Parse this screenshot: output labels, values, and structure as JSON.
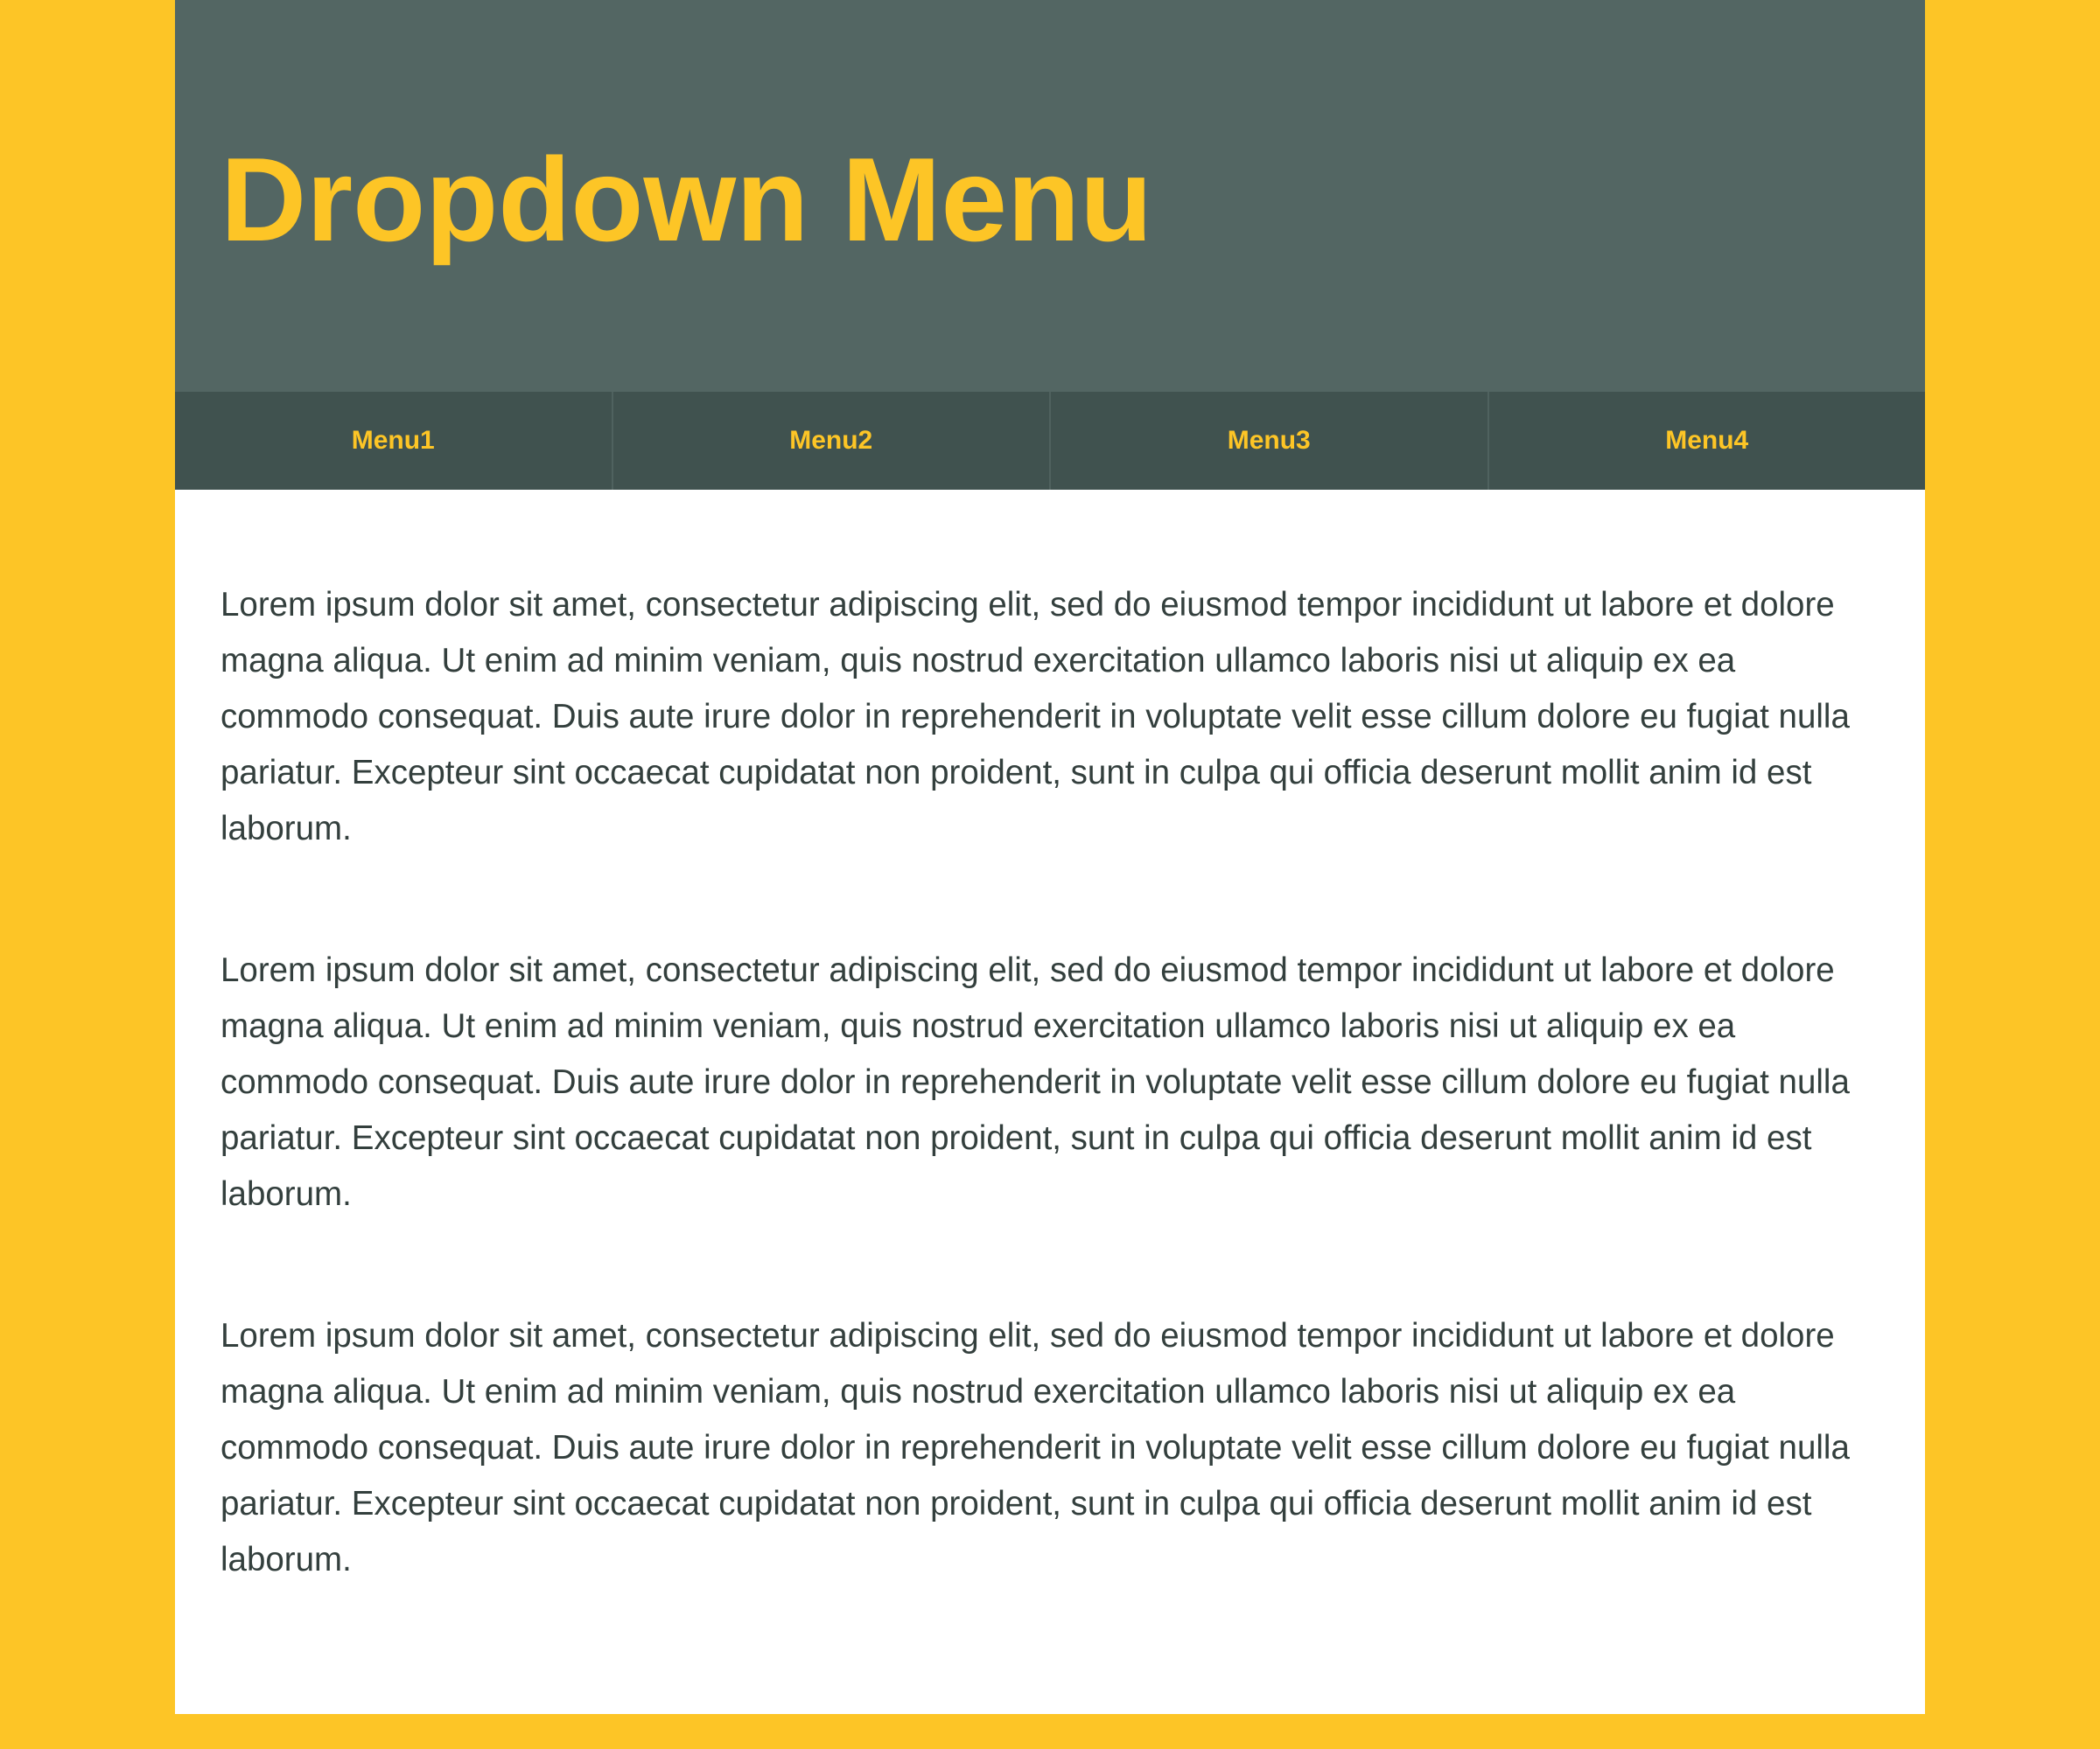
{
  "header": {
    "title": "Dropdown Menu"
  },
  "nav": {
    "items": [
      {
        "label": "Menu1"
      },
      {
        "label": "Menu2"
      },
      {
        "label": "Menu3"
      },
      {
        "label": "Menu4"
      }
    ]
  },
  "content": {
    "paragraphs": [
      "Lorem ipsum dolor sit amet, consectetur adipiscing elit, sed do eiusmod tempor incididunt ut labore et dolore magna aliqua. Ut enim ad minim veniam, quis nostrud exercitation ullamco laboris nisi ut aliquip ex ea commodo consequat. Duis aute irure dolor in reprehenderit in voluptate velit esse cillum dolore eu fugiat nulla pariatur. Excepteur sint occaecat cupidatat non proident, sunt in culpa qui officia deserunt mollit anim id est laborum.",
      "Lorem ipsum dolor sit amet, consectetur adipiscing elit, sed do eiusmod tempor incididunt ut labore et dolore magna aliqua. Ut enim ad minim veniam, quis nostrud exercitation ullamco laboris nisi ut aliquip ex ea commodo consequat. Duis aute irure dolor in reprehenderit in voluptate velit esse cillum dolore eu fugiat nulla pariatur. Excepteur sint occaecat cupidatat non proident, sunt in culpa qui officia deserunt mollit anim id est laborum.",
      "Lorem ipsum dolor sit amet, consectetur adipiscing elit, sed do eiusmod tempor incididunt ut labore et dolore magna aliqua. Ut enim ad minim veniam, quis nostrud exercitation ullamco laboris nisi ut aliquip ex ea commodo consequat. Duis aute irure dolor in reprehenderit in voluptate velit esse cillum dolore eu fugiat nulla pariatur. Excepteur sint occaecat cupidatat non proident, sunt in culpa qui officia deserunt mollit anim id est laborum."
    ]
  },
  "colors": {
    "background": "#fdc526",
    "header": "#536663",
    "nav": "#40524f",
    "accent": "#fdc526",
    "text": "#333f3d",
    "content_bg": "#ffffff"
  }
}
